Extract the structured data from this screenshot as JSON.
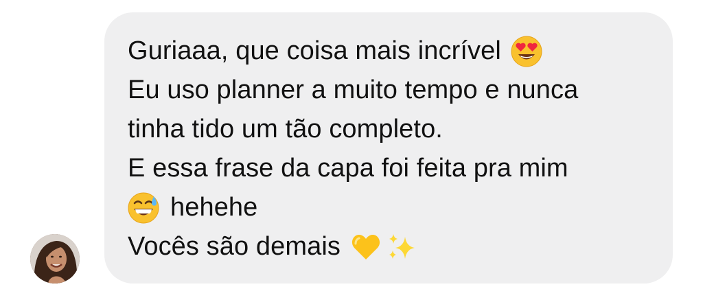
{
  "message": {
    "lines": [
      {
        "text": "Guriaaa, que coisa mais incrível",
        "emoji_after": "heart-eyes-emoji"
      },
      {
        "text": "Eu uso planner a muito tempo e nunca"
      },
      {
        "text": "tinha tido um tão completo."
      },
      {
        "text": "E essa frase da capa foi feita pra mim"
      },
      {
        "text": "hehehe",
        "emoji_before": "grinning-sweat-emoji"
      },
      {
        "text": "Vocês são demais",
        "emoji_after": [
          "yellow-heart-emoji",
          "sparkles-emoji"
        ]
      }
    ]
  },
  "sender": {
    "avatar": "avatar-photo"
  },
  "colors": {
    "bubble_background": "#efeff0",
    "text": "#111111",
    "page_background": "#ffffff"
  }
}
